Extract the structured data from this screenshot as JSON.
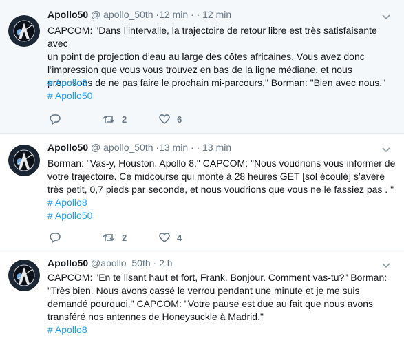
{
  "tweets": [
    {
      "display_name": "Apollo50",
      "handle": "@ apollo_50th",
      "time_a": "12 min",
      "time_b": "12 min",
      "text": "CAPCOM: \"Dans l’intervalle, la trajectoire de retour libre est très satisfaisante avec\nun point de projection d’eau au large des côtes africaines. Vous avez donc\nl’impression que vous vous trouvez en bas de la ligne médiane, et nous\nproposons de ne pas faire le prochain mi-parcours.\" Borman: \"Bien avec nous.\"",
      "hashtags": [
        "# Apollo8",
        "# Apollo50"
      ],
      "reply_count": "",
      "retweet_count": "2",
      "like_count": "6"
    },
    {
      "display_name": "Apollo50",
      "handle": "@ apollo_50th",
      "time_a": "13 min",
      "time_b": "13 min",
      "text": "Borman: \"Vas-y, Houston. Apollo 8.\" CAPCOM: \"Nous voudrions vous informer de\nvotre trajectoire. Ce midcourse qui monte à 28 heures GET [sol écoulé] s’avère\ntrès petit, 0,7 pieds par seconde, et nous voudrions que vous ne le fassiez pas . \"",
      "hashtags": [
        "# Apollo8",
        "# Apollo50"
      ],
      "reply_count": "",
      "retweet_count": "2",
      "like_count": "4"
    },
    {
      "display_name": "Apollo50",
      "handle": "@apollo_50th",
      "time_a": "2 h",
      "time_b": "",
      "text": "CAPCOM: \"En te lisant haut et fort, Frank. Bonjour. Comment vas-tu?\" Borman:\n\"Très bien. Nous avons cassé le verrou pendant une minute et je me suis\ndemandé pourquoi.\" CAPCOM: \"Votre pause est due au fait que nous avons\ntransféré nos antennes de Honeysuckle à Madrid.\"",
      "hashtags": [
        "# Apollo8"
      ],
      "reply_count": "",
      "retweet_count": "",
      "like_count": ""
    }
  ],
  "seal_text": {
    "top": "APOLLO",
    "bottom": "NASA"
  },
  "colors": {
    "accent": "#1da1f2",
    "muted": "#657786",
    "text": "#14171a",
    "highlight_bg": "#f5f8fa"
  }
}
